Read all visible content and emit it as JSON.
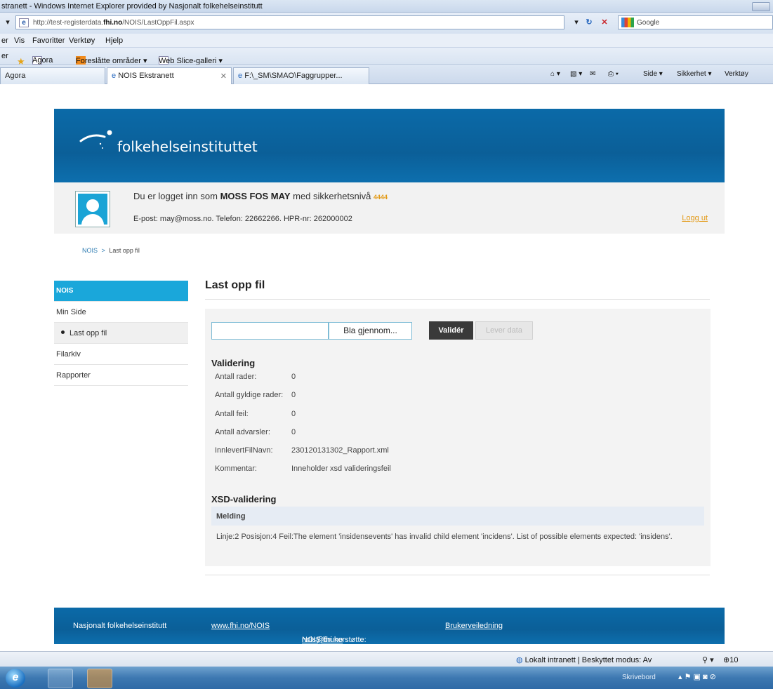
{
  "browser": {
    "window_title": "stranett - Windows Internet Explorer provided by Nasjonalt folkehelseinstitutt",
    "url_prefix": "http://test-registerdata.",
    "url_bold": "fhi.no",
    "url_suffix": "/NOIS/LastOppFil.aspx",
    "search_placeholder": "Google",
    "menu": [
      "er",
      "Vis",
      "Favoritter",
      "Verktøy",
      "Hjelp"
    ],
    "favorites": [
      "er",
      "Agora",
      "Foreslåtte områder ▾",
      "Web Slice-galleri ▾"
    ],
    "tabs": [
      "Agora",
      "NOIS Ekstranett",
      "F:\\_SM\\SMAO\\Faggrupper..."
    ],
    "commands": [
      "Side ▾",
      "Sikkerhet ▾",
      "Verktøy"
    ],
    "status_zone": "Lokalt intranett | Beskyttet modus: Av",
    "zoom": "10",
    "desktop_label": "Skrivebord"
  },
  "header": {
    "logo_text": "folkehelseinstituttet"
  },
  "user": {
    "prefix": "Du er logget inn som ",
    "name": "MOSS FOS MAY",
    "suffix": " med sikkerhetsnivå ",
    "level": "4444",
    "contact": "E-post: may@moss.no.   Telefon: 22662266.   HPR-nr: 262000002",
    "logout": "Logg ut"
  },
  "breadcrumb": {
    "root": "NOIS",
    "sep": ">",
    "current": "Last opp fil"
  },
  "sidebar": {
    "heading": "NOIS",
    "items": [
      "Min Side",
      "Last opp fil",
      "Filarkiv",
      "Rapporter"
    ]
  },
  "main": {
    "title": "Last opp fil",
    "browse_label": "Bla gjennom...",
    "validate_label": "Validér",
    "deliver_label": "Lever data",
    "validation_heading": "Validering",
    "validation": [
      {
        "label": "Antall rader:",
        "value": "0"
      },
      {
        "label": "Antall gyldige rader:",
        "value": "0"
      },
      {
        "label": "Antall feil:",
        "value": "0"
      },
      {
        "label": "Antall advarsler:",
        "value": "0"
      },
      {
        "label": "InnlevertFilNavn:",
        "value": "230120131302_Rapport.xml"
      },
      {
        "label": "Kommentar:",
        "value": "Inneholder xsd valideringsfeil"
      }
    ],
    "xsd_heading": "XSD-validering",
    "message_header": "Melding",
    "message": "Linje:2 Posisjon:4 Feil:The element 'insidensevents' has invalid child element 'incidens'. List of possible elements expected: 'insidens'."
  },
  "footer": {
    "org": "Nasjonalt folkehelseinstitutt",
    "link": "www.fhi.no/NOIS",
    "support_label": "NOIS brukerstøtte: ",
    "support_email": "nois@fhi.no",
    "guide": "Brukerveiledning"
  },
  "colors": {
    "brand_blue": "#0b6aa8",
    "accent_cyan": "#1aa7da",
    "logout_orange": "#e39a16"
  }
}
